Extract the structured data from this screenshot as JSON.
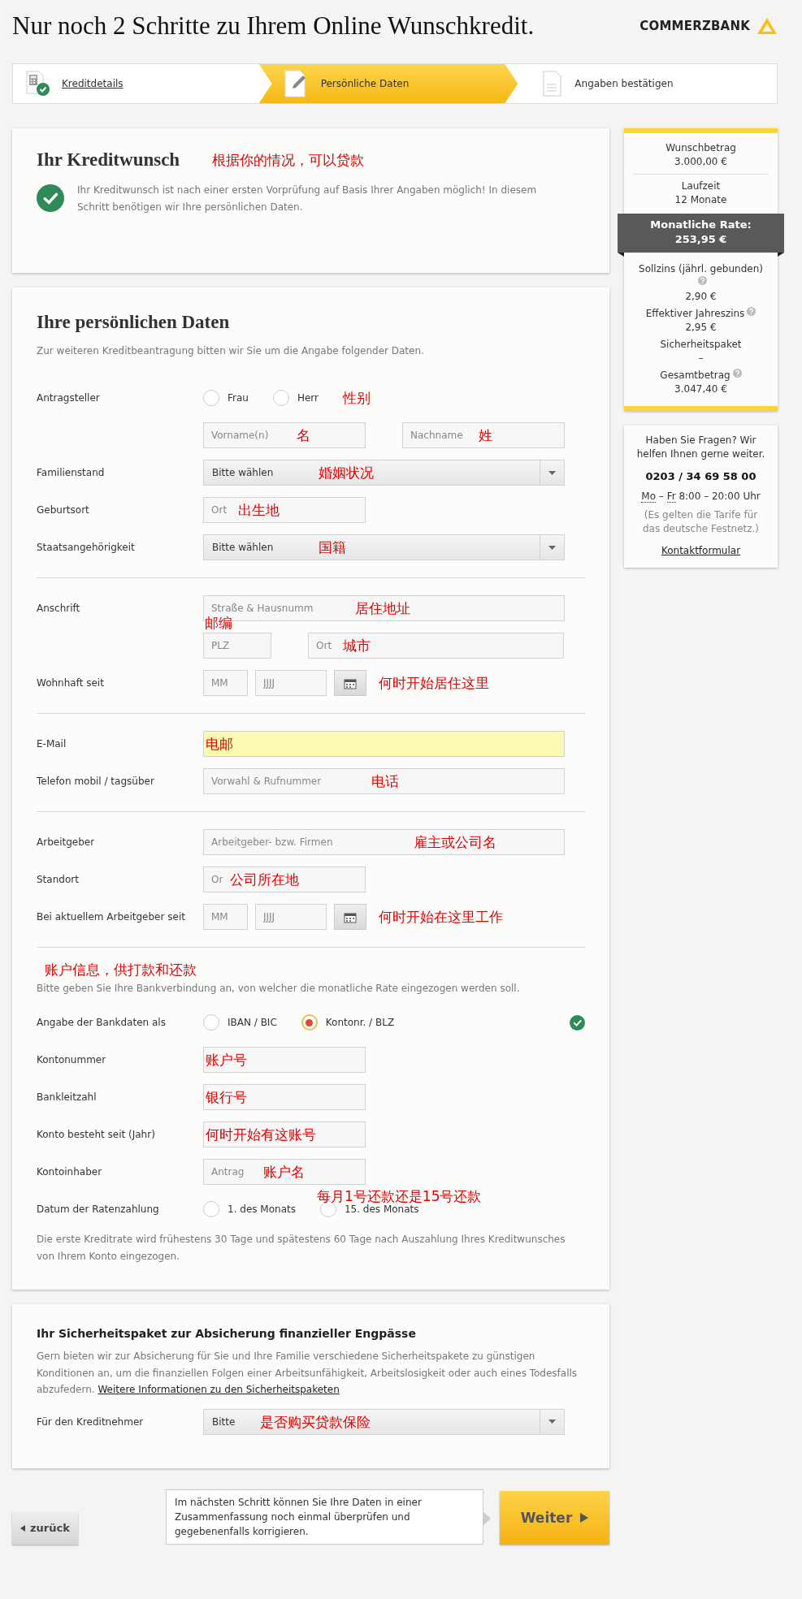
{
  "header": {
    "title": "Nur noch 2 Schritte zu Ihrem Online Wunschkredit.",
    "logo": "COMMERZBANK"
  },
  "steps": [
    {
      "label": "Kreditdetails",
      "selected": false,
      "completed": true
    },
    {
      "label": "Persönliche Daten",
      "selected": true,
      "completed": false
    },
    {
      "label": "Angaben bestätigen",
      "selected": false,
      "completed": false
    }
  ],
  "credit_wish": {
    "title": "Ihr Kreditwunsch",
    "note": "根据你的情况，可以贷款",
    "message": "Ihr Kreditwunsch ist nach einer ersten Vorprüfung auf Basis Ihrer Angaben möglich! In diesem Schritt benötigen wir Ihre persönlichen Daten.",
    "approved": true
  },
  "personal": {
    "title": "Ihre persönlichen Daten",
    "intro": "Zur weiteren Kreditbeantragung bitten wir Sie um die Angabe folgender Daten.",
    "rows": [
      {
        "kind": "radio",
        "label": "Antragsteller",
        "options": [
          {
            "label": "Frau",
            "selected": false
          },
          {
            "label": "Herr",
            "selected": false
          }
        ],
        "note": "性别"
      },
      {
        "kind": "fields",
        "fields": [
          {
            "kind": "short",
            "placeholder": "Vorname(n)",
            "note": "名"
          },
          {
            "kind": "short",
            "placeholder": "Nachname",
            "note": "姓"
          }
        ]
      },
      {
        "kind": "select",
        "label": "Familienstand",
        "value": "Bitte wählen",
        "note": "婚姻状况"
      },
      {
        "kind": "fields",
        "label": "Geburtsort",
        "fields": [
          {
            "kind": "short",
            "placeholder": "Ort",
            "note": "出生地"
          }
        ]
      },
      {
        "kind": "select",
        "label": "Staatsangehörigkeit",
        "value": "Bitte wählen",
        "note": "国籍"
      },
      {
        "kind": "divider"
      },
      {
        "kind": "fields",
        "label": "Anschrift",
        "fields": [
          {
            "kind": "long",
            "placeholder": "Straße & Hausnumm",
            "note": "居住地址"
          }
        ]
      },
      {
        "kind": "fields",
        "fields": [
          {
            "kind": "plz",
            "placeholder": "PLZ",
            "note_above": "邮编"
          },
          {
            "kind": "city",
            "placeholder": "Ort",
            "note": "城市"
          }
        ]
      },
      {
        "kind": "date",
        "label": "Wohnhaft seit",
        "fields": [
          {
            "kind": "month",
            "placeholder": "MM"
          },
          {
            "kind": "year",
            "placeholder": "JJJJ"
          }
        ],
        "note": "何时开始居住这里"
      },
      {
        "kind": "divider"
      },
      {
        "kind": "fields",
        "label": "E-Mail",
        "fields": [
          {
            "kind": "long",
            "highlighted": true,
            "note": "电邮"
          }
        ]
      },
      {
        "kind": "fields",
        "label": "Telefon mobil / tagsüber",
        "fields": [
          {
            "kind": "long",
            "placeholder": "Vorwahl & Rufnummer",
            "note": "电话"
          }
        ]
      },
      {
        "kind": "divider"
      },
      {
        "kind": "fields",
        "label": "Arbeitgeber",
        "fields": [
          {
            "kind": "long",
            "placeholder": "Arbeitgeber- bzw. Firmen",
            "note": "雇主或公司名"
          }
        ]
      },
      {
        "kind": "fields",
        "label": "Standort",
        "fields": [
          {
            "kind": "short",
            "placeholder": "Or",
            "note": "公司所在地"
          }
        ]
      },
      {
        "kind": "date",
        "label": "Bei aktuellem Arbeitgeber seit",
        "fields": [
          {
            "kind": "month",
            "placeholder": "MM"
          },
          {
            "kind": "year",
            "placeholder": "JJJJ"
          }
        ],
        "note": "何时开始在这里工作"
      },
      {
        "kind": "divider"
      },
      {
        "kind": "annotation",
        "text": "账户信息，供打款和还款"
      },
      {
        "kind": "text",
        "text": "Bitte geben Sie Ihre Bankverbindung an, von welcher die monatliche Rate eingezogen werden soll."
      },
      {
        "kind": "radio",
        "label": "Angabe der Bankdaten als",
        "options": [
          {
            "label": "IBAN / BIC",
            "selected": false
          },
          {
            "label": "Kontonr. / BLZ",
            "selected": true
          }
        ],
        "valid": true
      },
      {
        "kind": "fields",
        "label": "Kontonummer",
        "fields": [
          {
            "kind": "short",
            "note": "账户号"
          }
        ]
      },
      {
        "kind": "fields",
        "label": "Bankleitzahl",
        "fields": [
          {
            "kind": "short",
            "note": "银行号"
          }
        ]
      },
      {
        "kind": "fields",
        "label": "Konto besteht seit (Jahr)",
        "fields": [
          {
            "kind": "short",
            "note": "何时开始有这账号"
          }
        ]
      },
      {
        "kind": "fields",
        "label": "Kontoinhaber",
        "fields": [
          {
            "kind": "short",
            "placeholder": "Antrag",
            "note": "账户名"
          }
        ]
      },
      {
        "kind": "radio",
        "label": "Datum der Ratenzahlung",
        "options": [
          {
            "label": "1. des Monats",
            "selected": false
          },
          {
            "label": "15. des Monats",
            "selected": false
          }
        ],
        "note_above": "每月1号还款还是15号还款"
      },
      {
        "kind": "text",
        "text": "Die erste Kreditrate wird frühestens 30 Tage und spätestens 60 Tage nach Auszahlung Ihres Kreditwunsches von Ihrem Konto eingezogen."
      }
    ]
  },
  "insurance": {
    "title": "Ihr Sicherheitspaket zur Absicherung finanzieller Engpässe",
    "text": "Gern bieten wir zur Absicherung für Sie und Ihre Familie verschiedene Sicherheitspakete zu günstigen Konditionen an, um die finanziellen Folgen einer Arbeitsunfähigkeit, Arbeitslosigkeit oder auch eines Todesfalls abzufedern.",
    "link": "Weitere Informationen zu den Sicherheitspaketen",
    "label": "Für den Kreditnehmer",
    "value": "Bitte",
    "note": "是否购买贷款保险"
  },
  "summary": {
    "items": [
      {
        "label": "Wunschbetrag",
        "value": "3.000,00 €"
      },
      {
        "label": "Laufzeit",
        "value": "12 Monate"
      }
    ],
    "rate": {
      "label": "Monatliche Rate:",
      "value": "253,95 €"
    },
    "details": [
      {
        "label": "Sollzins (jährl. gebunden)",
        "value": "2,90 €",
        "help": true
      },
      {
        "label": "Effektiver Jahreszins",
        "value": "2,95 €",
        "help": true
      },
      {
        "label": "Sicherheitspaket",
        "value": "–",
        "help": false
      },
      {
        "label": "Gesamtbetrag",
        "value": "3.047,40 €",
        "help": true
      }
    ]
  },
  "help": {
    "question": "Haben Sie Fragen? Wir helfen Ihnen gerne weiter.",
    "phone": "0203 / 34 69 58 00",
    "day_from": "Mo",
    "day_sep": "–",
    "day_to": "Fr",
    "time": "8:00 – 20:00 Uhr",
    "tariff": "(Es gelten die Tarife für das deutsche Festnetz.)",
    "link": "Kontaktformular"
  },
  "footer": {
    "back": "zurück",
    "info": "Im nächsten Schritt können Sie Ihre Daten in einer Zusammenfassung noch einmal überprüfen und gegebenenfalls korrigieren.",
    "next": "Weiter"
  }
}
